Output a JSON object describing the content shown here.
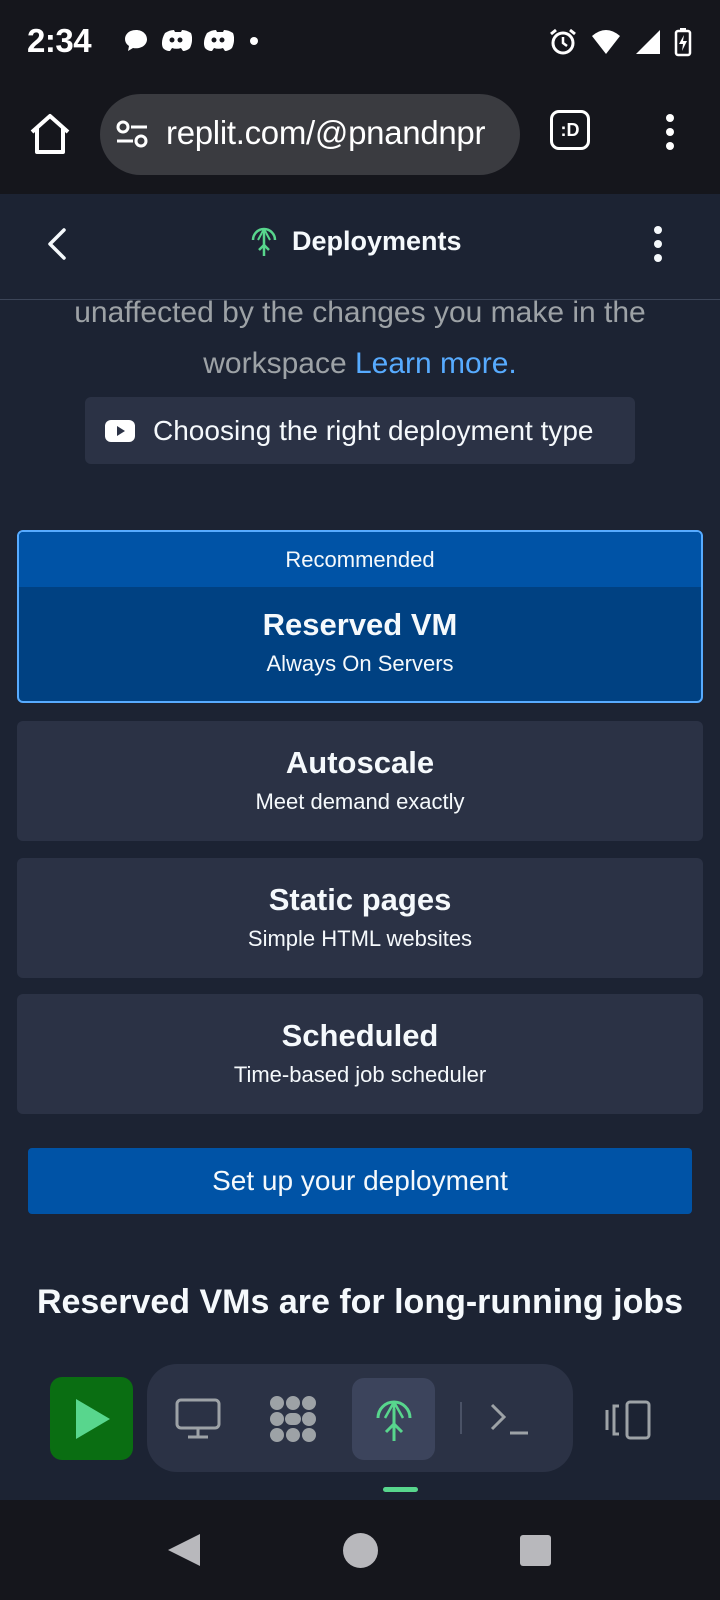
{
  "status_bar": {
    "time": "2:34"
  },
  "browser": {
    "url": "replit.com/@pnandnpr"
  },
  "header": {
    "title": "Deployments"
  },
  "intro": {
    "text": "unaffected by the changes you make in the workspace ",
    "link": "Learn more."
  },
  "video_chip": {
    "label": "Choosing the right deployment type"
  },
  "deployment_types": {
    "recommended_label": "Recommended",
    "items": [
      {
        "title": "Reserved VM",
        "subtitle": "Always On Servers"
      },
      {
        "title": "Autoscale",
        "subtitle": "Meet demand exactly"
      },
      {
        "title": "Static pages",
        "subtitle": "Simple HTML websites"
      },
      {
        "title": "Scheduled",
        "subtitle": "Time-based job scheduler"
      }
    ]
  },
  "setup_button": {
    "label": "Set up your deployment"
  },
  "section": {
    "heading": "Reserved VMs are for long-running jobs"
  },
  "toolbar": {
    "tools": [
      "run-icon",
      "monitor-icon",
      "workflow-icon",
      "deployments-icon",
      "terminal-icon",
      "panel-icon"
    ],
    "active_tool": "deployments-icon"
  },
  "colors": {
    "background": "#1c2333",
    "card": "#2b3245",
    "recommended_banner": "#0053a6",
    "recommended_body": "#004182",
    "accent_link": "#57abff",
    "run_button": "#0a6e12",
    "deployments_icon": "#58d68d"
  }
}
